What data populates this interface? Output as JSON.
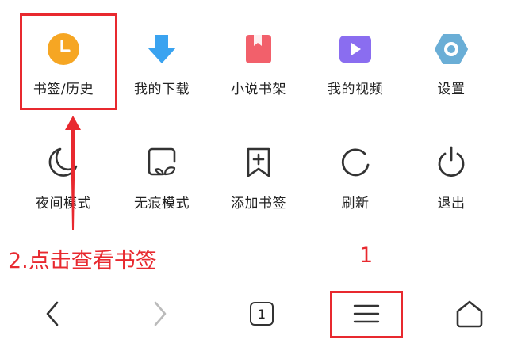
{
  "menu": {
    "row1": [
      {
        "label": "书签/历史",
        "icon": "clock-icon"
      },
      {
        "label": "我的下载",
        "icon": "download-arrow-icon"
      },
      {
        "label": "小说书架",
        "icon": "book-icon"
      },
      {
        "label": "我的视频",
        "icon": "video-play-icon"
      },
      {
        "label": "设置",
        "icon": "settings-hexagon-icon"
      }
    ],
    "row2": [
      {
        "label": "夜间模式",
        "icon": "moon-icon"
      },
      {
        "label": "无痕模式",
        "icon": "incognito-icon"
      },
      {
        "label": "添加书签",
        "icon": "add-bookmark-icon"
      },
      {
        "label": "刷新",
        "icon": "refresh-icon"
      },
      {
        "label": "退出",
        "icon": "power-icon"
      }
    ]
  },
  "annotations": {
    "step2": "2.点击查看书签",
    "step1": "1"
  },
  "bottom_nav": {
    "tab_count": "1",
    "icons": [
      "back-chevron-icon",
      "forward-chevron-icon",
      "tabs-icon",
      "menu-icon",
      "home-icon"
    ]
  },
  "colors": {
    "accent_red": "#e8292f",
    "clock_orange": "#f6a623",
    "download_blue": "#3aa3f0",
    "book_red": "#f2606b",
    "video_purple": "#8a6df0",
    "settings_blue": "#6aaed6"
  }
}
